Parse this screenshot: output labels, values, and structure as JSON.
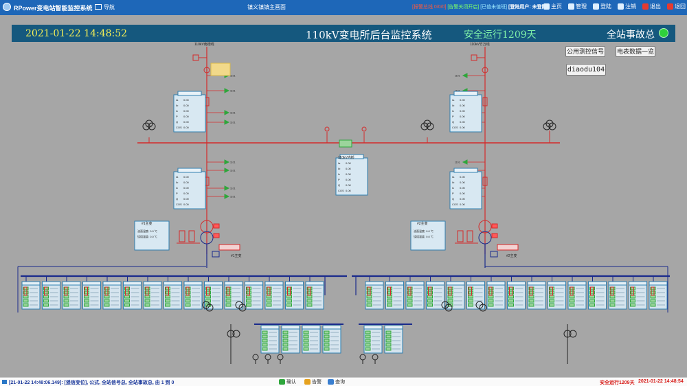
{
  "topbar": {
    "app_title": "RPower变电站智能监控系统",
    "nav_label": "导航",
    "center_title": "镇义镇镇主画面",
    "status_alarm": "[报警总线 0/0/0]",
    "status_sound": "[告警关闭开启]",
    "status_duty": "[已值未值班]",
    "login_user_label": "[登陆用户:",
    "login_user_value": "未登陆]",
    "menu": [
      {
        "label": "主页",
        "icon": "home-icon"
      },
      {
        "label": "管理",
        "icon": "manage-icon"
      },
      {
        "label": "登陆",
        "icon": "login-icon"
      },
      {
        "label": "注销",
        "icon": "logout-icon"
      },
      {
        "label": "退出",
        "icon": "exit-icon"
      },
      {
        "label": "退回",
        "icon": "back-icon"
      }
    ]
  },
  "header": {
    "datetime": "2021-01-22  14:48:52",
    "title": "110kV变电所后台监控系统",
    "safe_run": "安全运行1209天",
    "station_fault": "全站事故总",
    "lamp_color": "#2fd13c"
  },
  "buttons": {
    "public_signal": "公用测控信号",
    "meter_data": "电表数据一览",
    "diaodu": "diaodu104"
  },
  "diagram": {
    "left_incoming": "110kV南德线",
    "right_incoming": "110kV竹万线",
    "bus_section": "110kV内桥",
    "left_main_transformer": "#1主变",
    "right_main_transformer": "#2主变",
    "left_low_side": "#1主变",
    "right_low_side": "#2主变",
    "meas_labels": [
      "Ia",
      "Ib",
      "Ic",
      "P",
      "Q",
      "COS"
    ],
    "colors": {
      "high_voltage": "#d42a2a",
      "low_voltage": "#1a2a8c",
      "panel": "#2f7fb0",
      "device": "#2fa63c"
    }
  },
  "bottombar": {
    "log": "[21-01-22 14:48:06.149]: [遥信变位], 公式, 全站信号总, 全站事故总, 由 1 到 0",
    "confirm": "确认",
    "alarm": "告警",
    "query": "查询",
    "safe_run": "安全运行1209天",
    "datetime": "2021-01-22 14:48:54"
  }
}
